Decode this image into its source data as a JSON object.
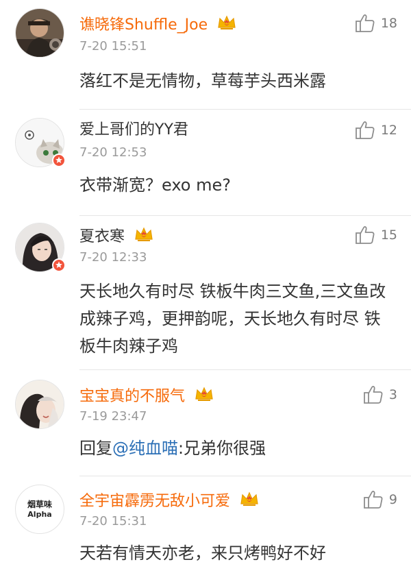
{
  "comments": [
    {
      "username": "谯晓锋Shuffle_Joe",
      "vip": true,
      "verified": false,
      "time": "7-20 15:51",
      "likes": "18",
      "text": "落红不是无情物，草莓芋头西米露",
      "avatar_icon": "avatar-photo-man-icon"
    },
    {
      "username": "爱上哥们的YY君",
      "vip": false,
      "verified": true,
      "time": "7-20 12:53",
      "likes": "12",
      "text": "衣带渐宽？exo me?",
      "avatar_icon": "avatar-cat-cartoon-icon"
    },
    {
      "username": "夏衣寒",
      "vip": false,
      "verified": true,
      "crown": true,
      "time": "7-20 12:33",
      "likes": "15",
      "text": "天长地久有时尽 铁板牛肉三文鱼,三文鱼改成辣子鸡，更押韵呢，天长地久有时尽 铁板牛肉辣子鸡",
      "avatar_icon": "avatar-photo-woman-icon"
    },
    {
      "username": "宝宝真的不服气",
      "vip": true,
      "verified": false,
      "time": "7-19 23:47",
      "likes": "3",
      "reply_prefix": "回复",
      "mention": "@纯血喵",
      "reply_rest": ":兄弟你很强",
      "avatar_icon": "avatar-anime-illustration-icon"
    },
    {
      "username": "全宇宙霹雳无敌小可爱",
      "vip": true,
      "verified": false,
      "time": "7-20 15:31",
      "likes": "9",
      "text": "天若有情天亦老，来只烤鸭好不好",
      "avatar_icon": "avatar-text-logo-icon",
      "avatar_text_line1": "烟草味",
      "avatar_text_line2": "Alpha"
    }
  ],
  "colors": {
    "vip_name": "#f66a0a",
    "normal_name": "#333333",
    "time": "#9a9a9a",
    "mention": "#2b6fb6",
    "crown": "#f5b400",
    "verified_badge": "#f2543c"
  }
}
